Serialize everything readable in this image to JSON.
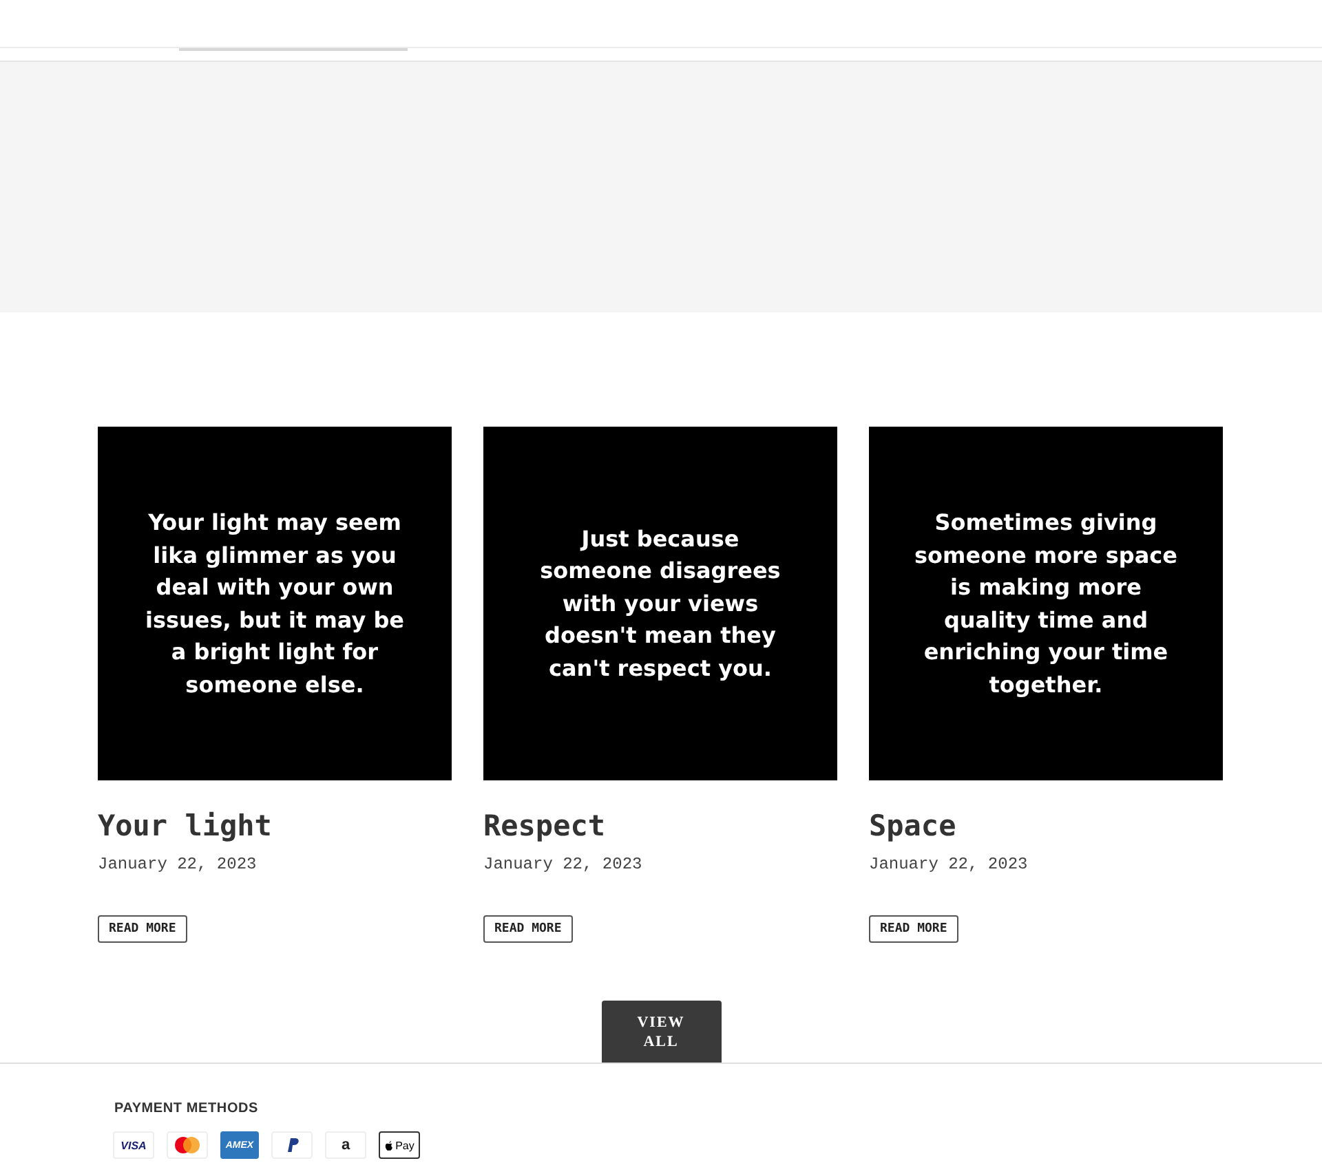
{
  "articles": [
    {
      "image_text": "Your light may seem lika glimmer as you deal with your own issues, but it may be a bright light for someone else.",
      "title": "Your light",
      "date": "January 22, 2023",
      "button": "READ MORE"
    },
    {
      "image_text": "Just because someone disagrees with your views doesn't mean they can't respect you.",
      "title": "Respect",
      "date": "January 22, 2023",
      "button": "READ MORE"
    },
    {
      "image_text": "Sometimes giving someone more space is making more quality time and enriching your time together.",
      "title": "Space",
      "date": "January 22, 2023",
      "button": "READ MORE"
    }
  ],
  "view_all": "VIEW ALL",
  "footer": {
    "heading": "PAYMENT METHODS",
    "payment_methods": [
      {
        "kind": "visa",
        "label": "VISA"
      },
      {
        "kind": "mastercard"
      },
      {
        "kind": "amex",
        "label": "AMEX"
      },
      {
        "kind": "paypal"
      },
      {
        "kind": "amazon",
        "label": "a"
      },
      {
        "kind": "applepay",
        "label": "Pay"
      }
    ]
  }
}
